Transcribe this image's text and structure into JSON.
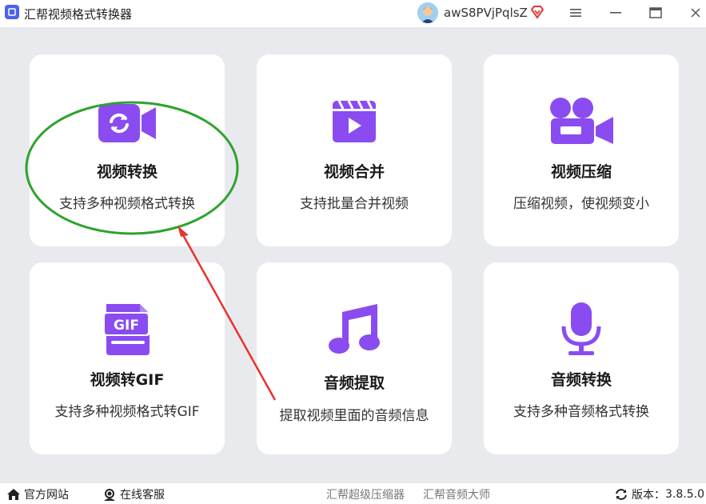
{
  "titlebar": {
    "app_title": "汇帮视频格式转换器",
    "username": "awS8PVjPqlsZ"
  },
  "cards": [
    {
      "title": "视频转换",
      "desc": "支持多种视频格式转换",
      "icon": "video-convert-icon"
    },
    {
      "title": "视频合并",
      "desc": "支持批量合并视频",
      "icon": "video-merge-icon"
    },
    {
      "title": "视频压缩",
      "desc": "压缩视频，使视频变小",
      "icon": "video-camera-icon"
    },
    {
      "title": "视频转GIF",
      "desc": "支持多种视频格式转GIF",
      "icon": "gif-file-icon"
    },
    {
      "title": "音频提取",
      "desc": "提取视频里面的音频信息",
      "icon": "music-note-icon"
    },
    {
      "title": "音频转换",
      "desc": "支持多种音频格式转换",
      "icon": "microphone-icon"
    }
  ],
  "footer": {
    "website": "官方网站",
    "support": "在线客服",
    "compressor": "汇帮超级压缩器",
    "audio_master": "汇帮音频大师",
    "version_label": "版本：",
    "version": "3.8.5.0"
  },
  "gif_icon_text": "GIF",
  "colors": {
    "accent": "#8a4cf0",
    "background": "#e9eaee",
    "annotation_circle": "#2ea32e",
    "annotation_arrow": "#e8322e"
  }
}
